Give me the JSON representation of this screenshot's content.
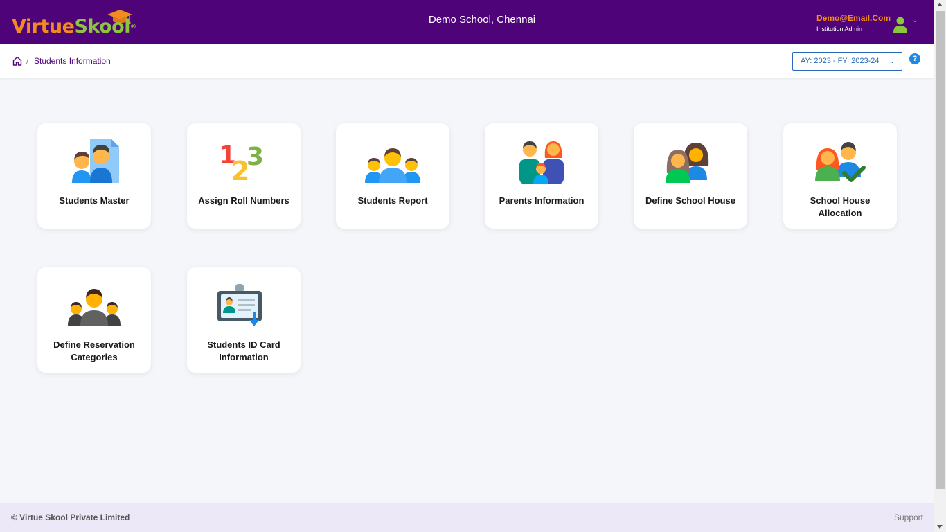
{
  "header": {
    "logo": {
      "part1": "Virtue",
      "part2": "Skool",
      "registered": "®"
    },
    "school_name": "Demo School, Chennai",
    "user": {
      "email": "Demo@Email.Com",
      "role": "Institution Admin"
    }
  },
  "breadcrumb": {
    "separator": "/",
    "current": "Students Information"
  },
  "academic_year": {
    "selected": "AY: 2023 - FY: 2023-24"
  },
  "help": {
    "label": "?"
  },
  "modules": [
    {
      "label": "Students Master",
      "icon": "students-master-icon"
    },
    {
      "label": "Assign Roll Numbers",
      "icon": "roll-numbers-icon"
    },
    {
      "label": "Students Report",
      "icon": "students-report-icon"
    },
    {
      "label": "Parents Information",
      "icon": "parents-icon"
    },
    {
      "label": "Define School House",
      "icon": "school-house-icon"
    },
    {
      "label": "School House Allocation",
      "icon": "house-allocation-icon"
    },
    {
      "label": "Define Reservation Categories",
      "icon": "reservation-icon"
    },
    {
      "label": "Students ID Card Information",
      "icon": "id-card-icon"
    }
  ],
  "footer": {
    "copyright": "© Virtue Skool Private Limited",
    "support": "Support"
  },
  "colors": {
    "header_bg": "#4e0378",
    "accent_orange": "#f28c22",
    "accent_green": "#8cc63f",
    "link_blue": "#2a68b8",
    "footer_bg": "#ede8f7"
  }
}
